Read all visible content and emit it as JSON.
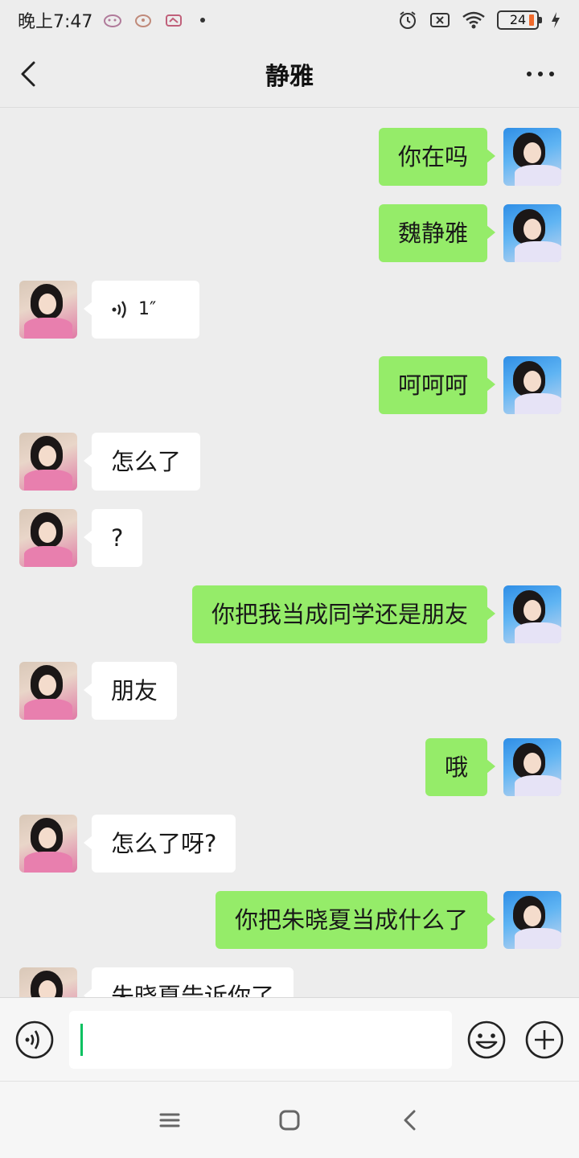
{
  "status_bar": {
    "time": "晚上7:47",
    "battery": "24",
    "icons": [
      "notification-icon",
      "notification-icon",
      "notification-icon",
      "alarm-icon",
      "no-sim-icon",
      "wifi-icon",
      "battery-icon",
      "charging-icon"
    ]
  },
  "header": {
    "title": "静雅",
    "back_icon": "chevron-left-icon",
    "more_icon": "more-dots-icon"
  },
  "messages": [
    {
      "side": "right",
      "type": "text",
      "text": "你在吗"
    },
    {
      "side": "right",
      "type": "text",
      "text": "魏静雅"
    },
    {
      "side": "left",
      "type": "voice",
      "text": "1″"
    },
    {
      "side": "right",
      "type": "text",
      "text": "呵呵呵"
    },
    {
      "side": "left",
      "type": "text",
      "text": "怎么了"
    },
    {
      "side": "left",
      "type": "text",
      "text": "?"
    },
    {
      "side": "right",
      "type": "text",
      "text": "你把我当成同学还是朋友"
    },
    {
      "side": "left",
      "type": "text",
      "text": "朋友"
    },
    {
      "side": "right",
      "type": "text",
      "text": "哦"
    },
    {
      "side": "left",
      "type": "text",
      "text": "怎么了呀?"
    },
    {
      "side": "right",
      "type": "text",
      "text": "你把朱晓夏当成什么了"
    },
    {
      "side": "left",
      "type": "text",
      "text": "朱晓夏告诉你了"
    }
  ],
  "input_bar": {
    "value": "",
    "voice_icon": "voice-icon",
    "emoji_icon": "emoji-icon",
    "plus_icon": "plus-icon"
  },
  "colors": {
    "background": "#ededed",
    "sent_bubble": "#95ec69",
    "received_bubble": "#ffffff",
    "caret": "#07c160"
  }
}
